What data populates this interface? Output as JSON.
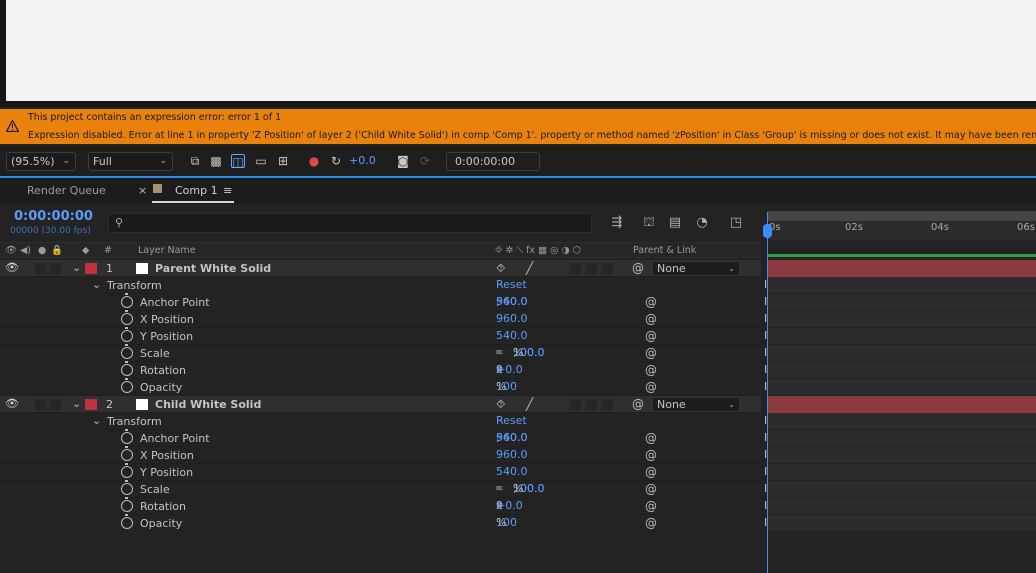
{
  "error": {
    "line1": "This project contains an expression error: error 1 of 1",
    "line2": "Expression disabled. Error at line 1 in property 'Z Position' of layer 2 ('Child White Solid') in comp 'Comp 1'.  property or method named 'zPosition' in Class 'Group' is missing or does not exist. It may have been renamed, moved, d"
  },
  "viewer_toolbar": {
    "zoom": "(95.5%)",
    "resolution": "Full",
    "exposure": "+0.0",
    "timecode": "0:00:00:00"
  },
  "tabs": [
    {
      "label": "Render Queue"
    },
    {
      "label": "Comp 1"
    }
  ],
  "timeline": {
    "current_time": "0:00:00:00",
    "frame_info": "00000 (30.00 fps)",
    "search_placeholder": "",
    "columns": {
      "hash": "#",
      "layer_name": "Layer Name",
      "parent_link": "Parent & Link"
    },
    "ruler": [
      "0s",
      "02s",
      "04s",
      "06s"
    ]
  },
  "layers": [
    {
      "index": "1",
      "name": "Parent White Solid",
      "parent": "None",
      "transform_label": "Transform",
      "reset": "Reset",
      "props": [
        {
          "name": "Anchor Point",
          "v1": "960.0",
          "sep": ",",
          "v2": "540.0",
          "unit": ""
        },
        {
          "name": "X Position",
          "v1": "960.0",
          "sep": "",
          "v2": "",
          "unit": ""
        },
        {
          "name": "Y Position",
          "v1": "540.0",
          "sep": "",
          "v2": "",
          "unit": ""
        },
        {
          "name": "Scale",
          "v1": "100.0",
          "sep": ",",
          "v2": "100.0",
          "unit": "%"
        },
        {
          "name": "Rotation",
          "v1": "0",
          "sep": "x",
          "v2": "+0.0",
          "unit": "°"
        },
        {
          "name": "Opacity",
          "v1": "100",
          "sep": "",
          "v2": "",
          "unit": "%"
        }
      ]
    },
    {
      "index": "2",
      "name": "Child White Solid",
      "parent": "None",
      "transform_label": "Transform",
      "reset": "Reset",
      "props": [
        {
          "name": "Anchor Point",
          "v1": "960.0",
          "sep": ",",
          "v2": "540.0",
          "unit": ""
        },
        {
          "name": "X Position",
          "v1": "960.0",
          "sep": "",
          "v2": "",
          "unit": ""
        },
        {
          "name": "Y Position",
          "v1": "540.0",
          "sep": "",
          "v2": "",
          "unit": ""
        },
        {
          "name": "Scale",
          "v1": "100.0",
          "sep": ",",
          "v2": "100.0",
          "unit": "%"
        },
        {
          "name": "Rotation",
          "v1": "0",
          "sep": "x",
          "v2": "+0.0",
          "unit": "°"
        },
        {
          "name": "Opacity",
          "v1": "100",
          "sep": "",
          "v2": "",
          "unit": "%"
        }
      ]
    }
  ],
  "colors": {
    "accent": "#5b9bff",
    "error_bg": "#e8820c",
    "layer_label": "#c0333e",
    "layer_bar": "#8b3a3f",
    "work_area": "#2e9e45"
  }
}
